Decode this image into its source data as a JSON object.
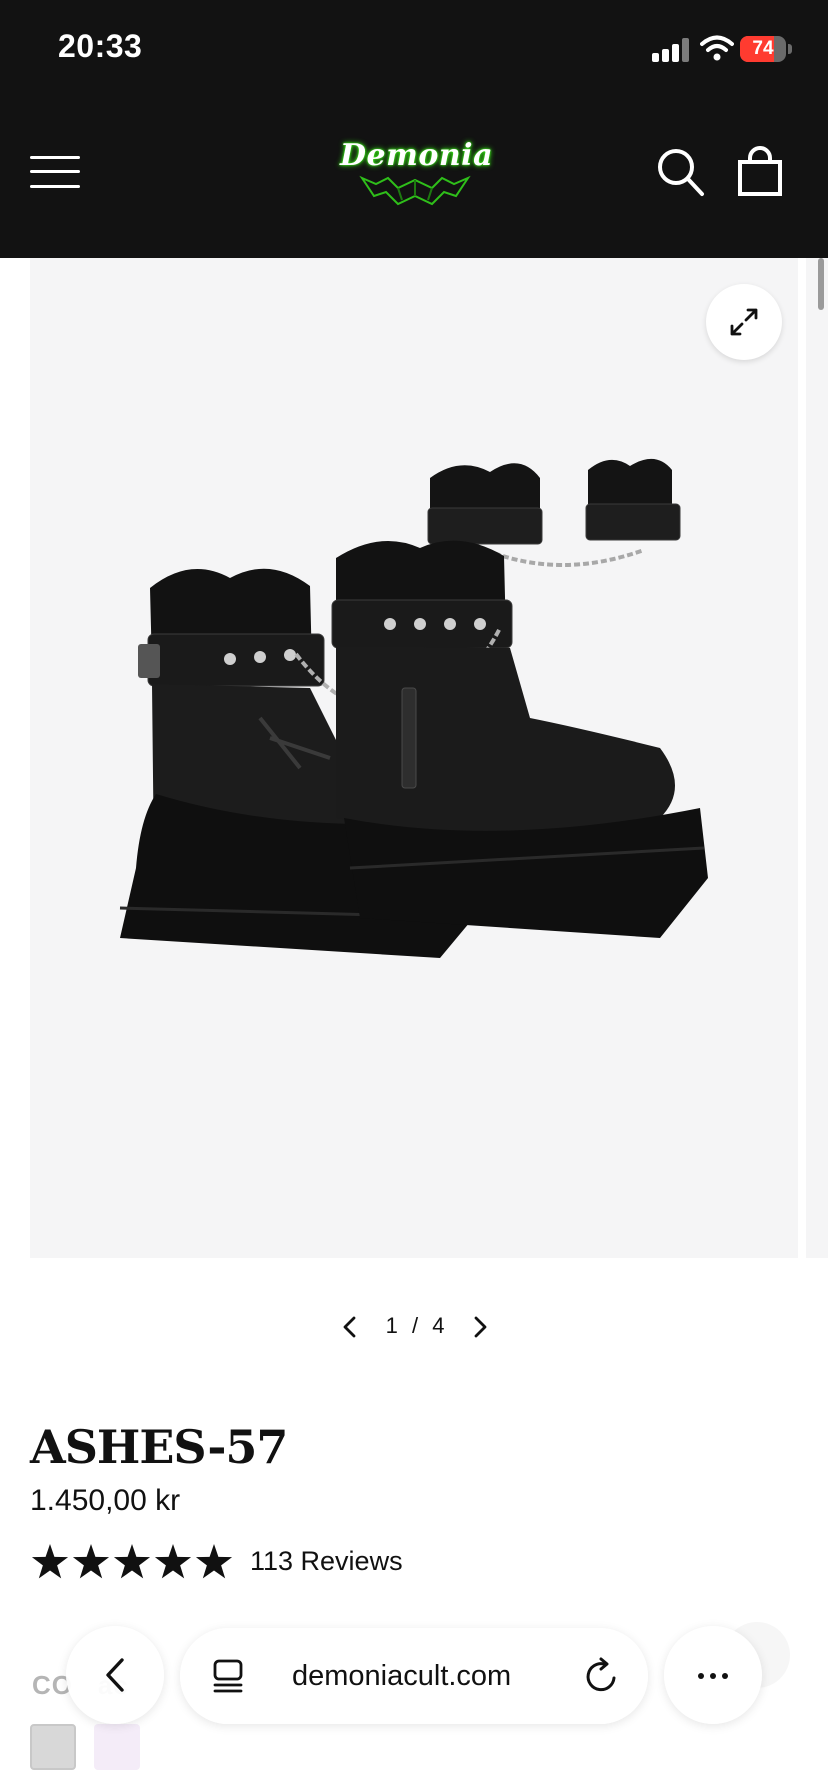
{
  "status_bar": {
    "time": "20:33",
    "battery_text": "74",
    "battery_level_percent": 74,
    "battery_color": "#ff3b30",
    "icons": [
      "cellular-signal-icon",
      "wifi-icon",
      "battery-charging-icon"
    ]
  },
  "header": {
    "logo_text": "Demonia",
    "icons": [
      "hamburger-menu-icon",
      "search-icon",
      "shopping-bag-icon"
    ],
    "background_color": "#121212",
    "logo_glow_color": "#39ff14"
  },
  "gallery": {
    "current": "1",
    "separator": "/",
    "total": "4",
    "icons": [
      "expand-icon",
      "chevron-left-icon",
      "chevron-right-icon"
    ]
  },
  "product": {
    "title": "ASHES-57",
    "price": "1.450,00 kr",
    "rating": 5,
    "reviews_label": "113 Reviews",
    "color_label": "CO    ac",
    "swatch_colors": [
      "#d8d8d8",
      "#f4ecf8"
    ]
  },
  "browser": {
    "url": "demoniacult.com",
    "icons": [
      "back-chevron-icon",
      "tabs-icon",
      "reload-icon",
      "more-dots-icon"
    ]
  }
}
